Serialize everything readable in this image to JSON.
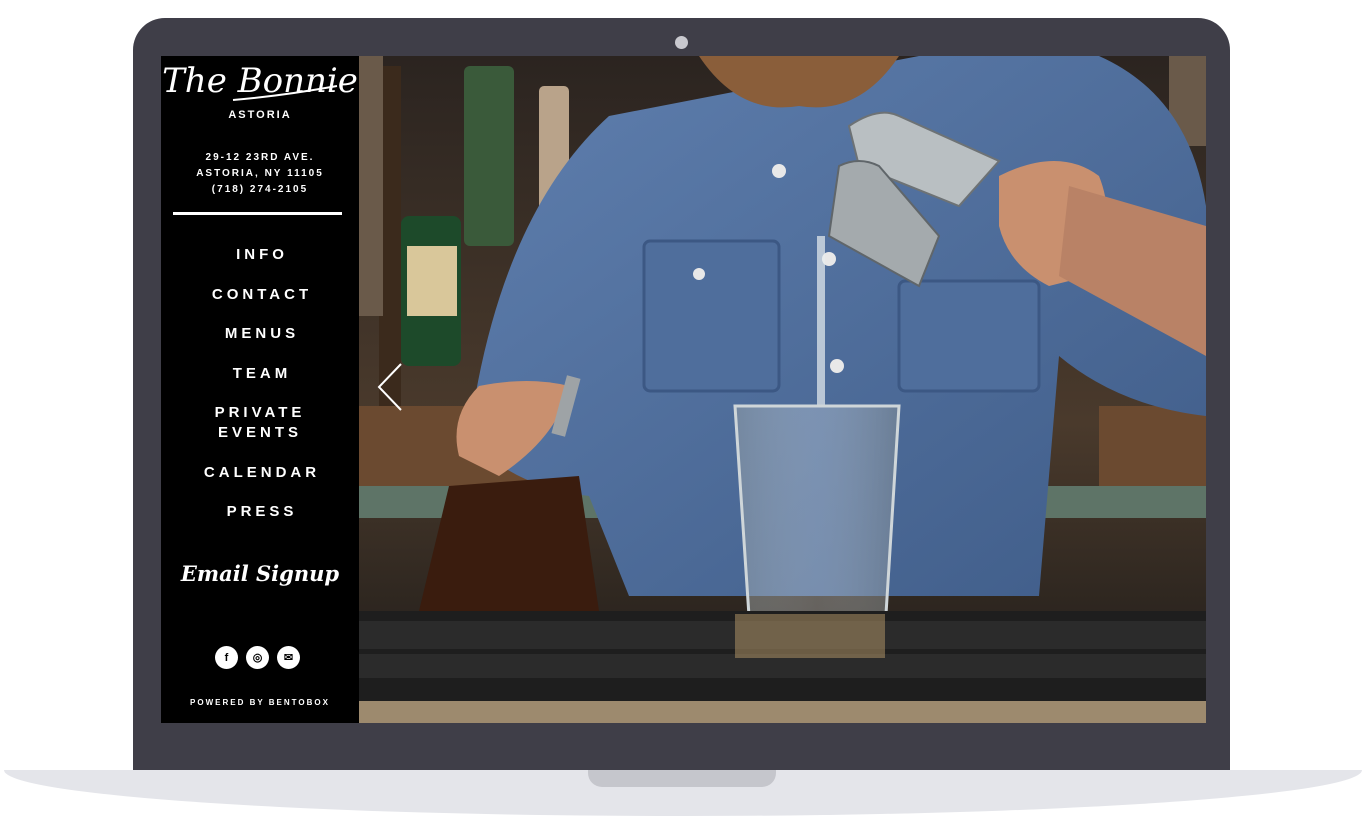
{
  "brand": {
    "logo_text": "The Bonnie",
    "location": "ASTORIA",
    "address_line1": "29-12 23RD AVE.",
    "address_line2": "ASTORIA, NY 11105",
    "phone": "(718) 274-2105"
  },
  "nav": {
    "items": [
      "INFO",
      "CONTACT",
      "MENUS",
      "TEAM",
      "PRIVATE EVENTS",
      "CALENDAR",
      "PRESS"
    ]
  },
  "email_signup_label": "Email Signup",
  "socials": [
    {
      "icon": "facebook-icon",
      "glyph": "f"
    },
    {
      "icon": "instagram-icon",
      "glyph": "◎"
    },
    {
      "icon": "email-icon",
      "glyph": "✉"
    }
  ],
  "footer": {
    "powered_by": "POWERED BY BENTOBOX"
  },
  "hero": {
    "icon": "chevron-left-icon"
  },
  "colors": {
    "device": "#3f3e48",
    "sidebar": "#000000",
    "text": "#ffffff"
  }
}
